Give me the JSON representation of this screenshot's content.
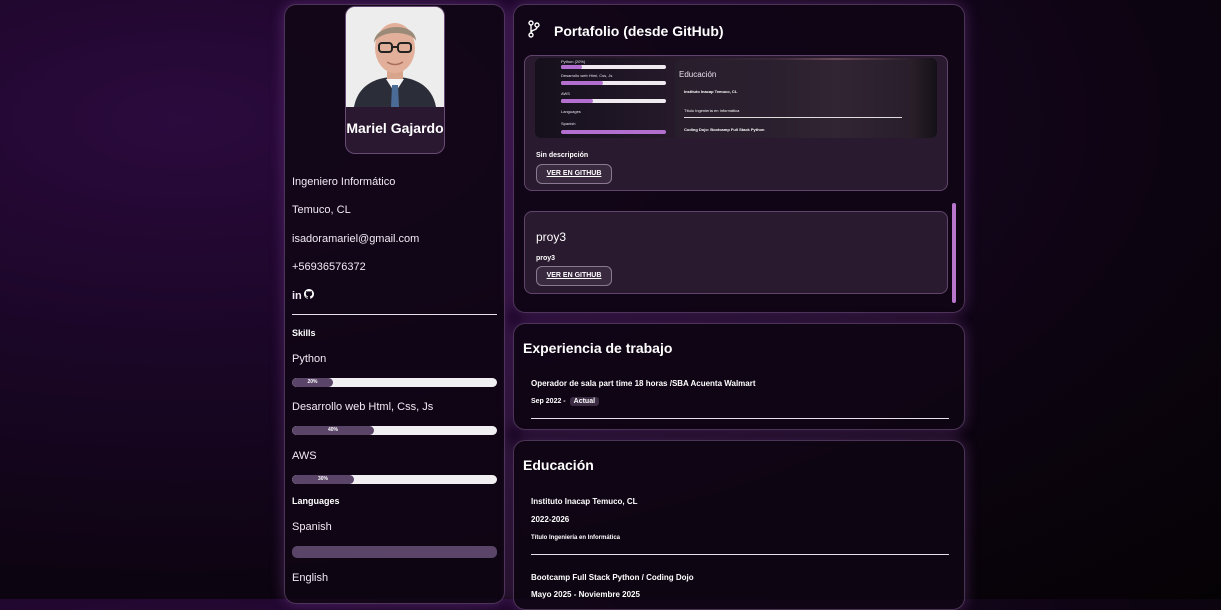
{
  "profile": {
    "name": "Mariel Gajardo",
    "title": "Ingeniero Informático",
    "location": "Temuco, CL",
    "email": "isadoramariel@gmail.com",
    "phone": "+56936576372",
    "social": {
      "linkedin_label": "in",
      "icons": [
        "linkedin-icon",
        "github-icon"
      ]
    }
  },
  "skills": {
    "label": "Skills",
    "items": [
      {
        "name": "Python",
        "percent_label": "20%",
        "percent": 20
      },
      {
        "name": "Desarrollo web Html, Css, Js",
        "percent_label": "40%",
        "percent": 40
      },
      {
        "name": "AWS",
        "percent_label": "30%",
        "percent": 30
      }
    ]
  },
  "languages": {
    "label": "Languages",
    "items": [
      {
        "name": "Spanish",
        "percent": 100
      },
      {
        "name": "English"
      }
    ]
  },
  "portfolio": {
    "title": "Portafolio (desde GitHub)",
    "icon": "git-branch-icon",
    "projects": [
      {
        "description": "Sin descripción",
        "button_label": "VER EN GITHUB",
        "preview": {
          "edu_label": "Educación",
          "edu_item": "Instituto Inacap Temuco, CL",
          "edu_degree": "Título Ingeniería en Informática",
          "bootcamp": "Coding Dojo: Bootcamp Full Stack Python",
          "skills": [
            "Python (20%)",
            "Desarrollo web Html, Css, Js",
            "AWS"
          ],
          "langs_label": "Languages",
          "lang": "Spanish"
        }
      },
      {
        "name": "proy3",
        "description": "proy3",
        "button_label": "VER EN GITHUB"
      }
    ]
  },
  "experience": {
    "title": "Experiencia de trabajo",
    "items": [
      {
        "role": "Operador de sala part time 18 horas /SBA Acuenta Walmart",
        "period": "Sep 2022 -",
        "badge": "Actual"
      }
    ]
  },
  "education": {
    "title": "Educación",
    "items": [
      {
        "institution": "Instituto Inacap Temuco, CL",
        "period": "2022-2026",
        "degree": "Título Ingeniería en Informática"
      },
      {
        "institution": "Bootcamp Full Stack Python / Coding Dojo",
        "period": "Mayo 2025 - Noviembre 2025"
      }
    ]
  },
  "colors": {
    "accent": "#b775cc",
    "bar_fill": "#5a4468",
    "bar_track": "#f1eff2",
    "panel_bg": "#0f0614"
  }
}
